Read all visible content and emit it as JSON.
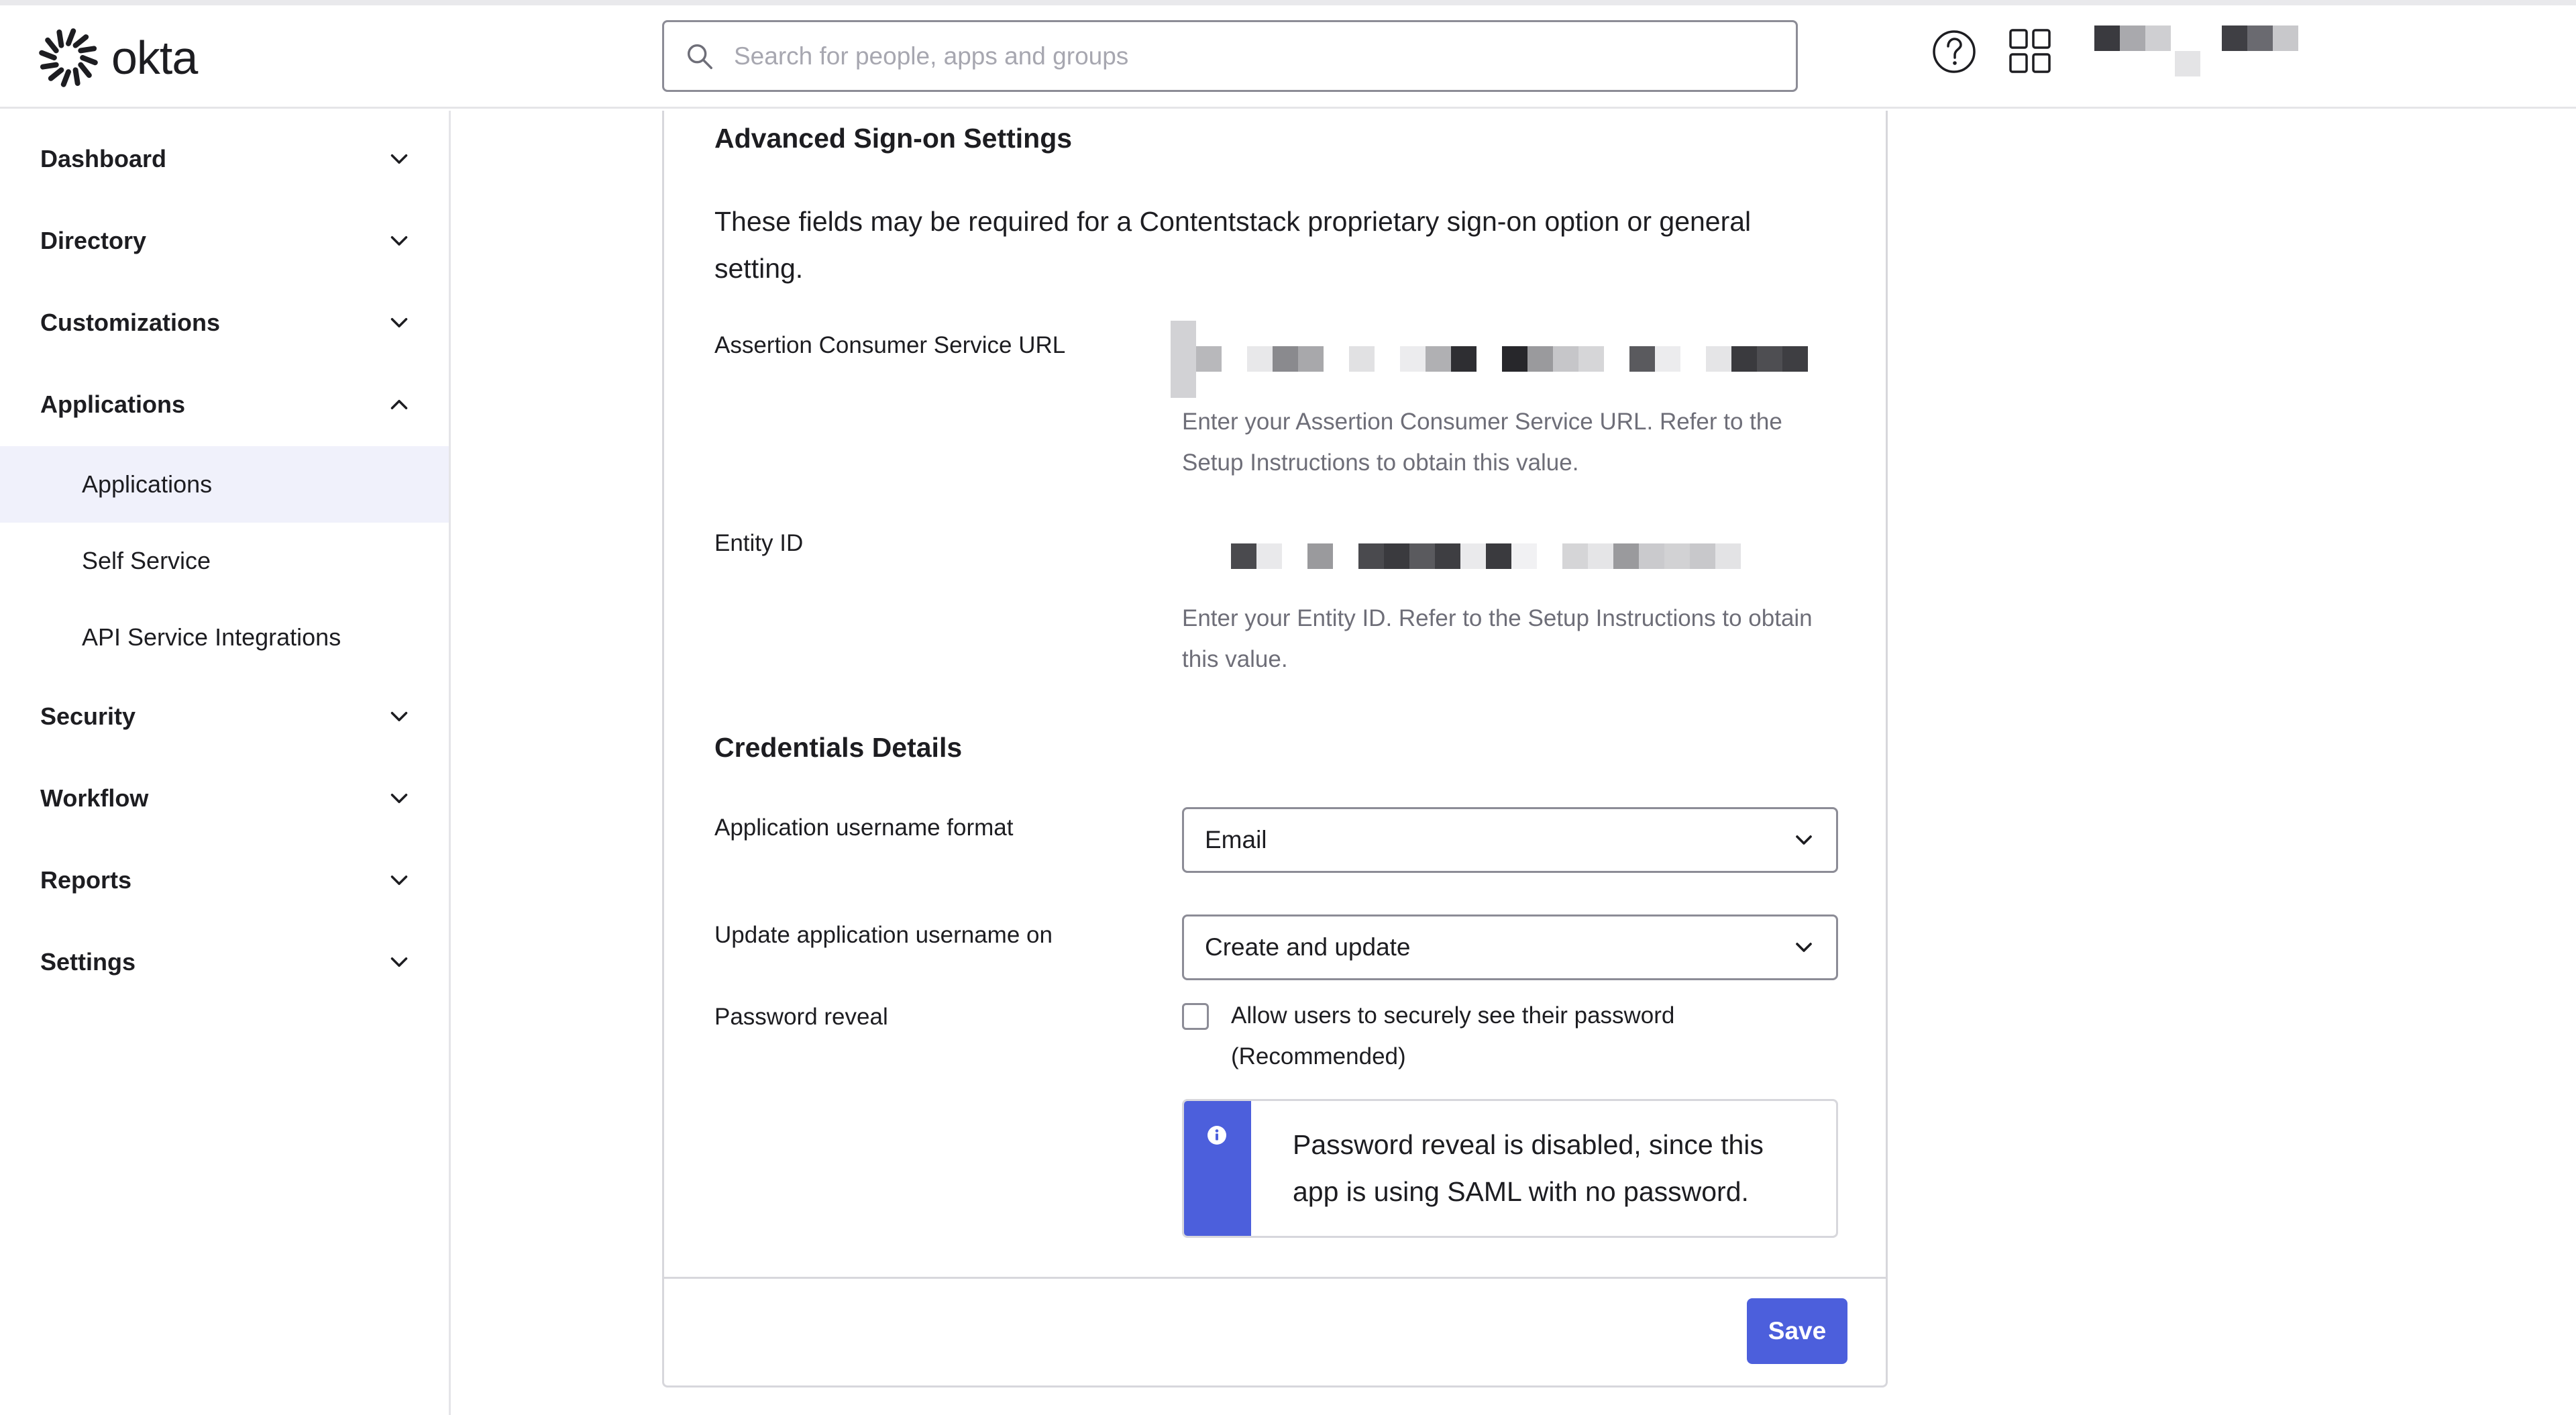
{
  "brand": {
    "name": "okta",
    "accent": "#4c5fdc"
  },
  "header": {
    "search_placeholder": "Search for people, apps and groups",
    "icons": [
      "search-icon",
      "help-icon",
      "app-grid-icon"
    ]
  },
  "sidebar": {
    "items": [
      {
        "label": "Dashboard",
        "expanded": false
      },
      {
        "label": "Directory",
        "expanded": false
      },
      {
        "label": "Customizations",
        "expanded": false
      },
      {
        "label": "Applications",
        "expanded": true
      },
      {
        "label": "Security",
        "expanded": false
      },
      {
        "label": "Workflow",
        "expanded": false
      },
      {
        "label": "Reports",
        "expanded": false
      },
      {
        "label": "Settings",
        "expanded": false
      }
    ],
    "applications_sub": [
      {
        "label": "Applications",
        "active": true
      },
      {
        "label": "Self Service",
        "active": false
      },
      {
        "label": "API Service Integrations",
        "active": false
      }
    ]
  },
  "main": {
    "advanced": {
      "title": "Advanced Sign-on Settings",
      "description": "These fields may be required for a Contentstack proprietary sign-on option or general setting.",
      "acs_label": "Assertion Consumer Service URL",
      "acs_hint": "Enter your Assertion Consumer Service URL. Refer to the Setup Instructions to obtain this value.",
      "entity_label": "Entity ID",
      "entity_hint": "Enter your Entity ID. Refer to the Setup Instructions to obtain this value."
    },
    "credentials": {
      "title": "Credentials Details",
      "username_format_label": "Application username format",
      "username_format_value": "Email",
      "update_on_label": "Update application username on",
      "update_on_value": "Create and update",
      "password_reveal_label": "Password reveal",
      "password_reveal_checkbox": "Allow users to securely see their password (Recommended)",
      "password_reveal_checked": false,
      "info_message": "Password reveal is disabled, since this app is using SAML with no password."
    },
    "save_label": "Save"
  }
}
